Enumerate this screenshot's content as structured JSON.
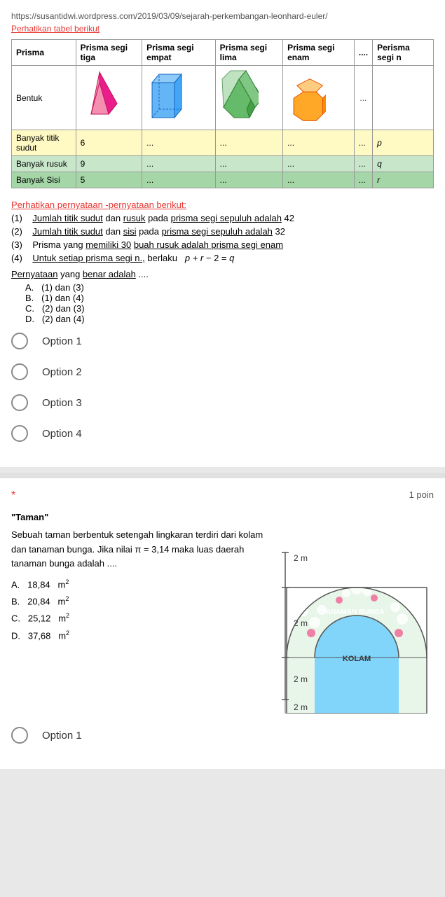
{
  "question1": {
    "url": "https://susantidwi.wordpress.com/2019/03/09/sejarah-perkembangan-leonhard-euler/",
    "note": "Perhatikan tabel berikut",
    "table": {
      "headers": [
        "Prisma",
        "Prisma segi tiga",
        "Prisma segi empat",
        "Prisma segi lima",
        "Prisma segi enam",
        "....",
        "Perisma segi n"
      ],
      "rows": [
        {
          "label": "Bentuk",
          "values": [
            "[shape-triangle]",
            "[shape-square]",
            "[shape-pentagon]",
            "[shape-hexagon]",
            "...",
            ""
          ]
        },
        {
          "label": "Banyak titik sudut",
          "values": [
            "6",
            "...",
            "...",
            "...",
            "...",
            "p"
          ],
          "class": "row-yellow"
        },
        {
          "label": "Banyak rusuk",
          "values": [
            "9",
            "...",
            "...",
            "...",
            "...",
            "q"
          ],
          "class": "row-green"
        },
        {
          "label": "Banyak Sisi",
          "values": [
            "5",
            "...",
            "...",
            "...",
            "...",
            "r"
          ],
          "class": "row-green2"
        }
      ]
    },
    "statements_header": "Perhatikan pernyataan -pernyataan berikut:",
    "statements": [
      "(1)   Jumlah titik sudut dan rusuk pada prisma segi sepuluh adalah 42",
      "(2)   Jumlah titik sudut dan sisi pada prisma segi sepuluh adalah 32",
      "(3)   Prisma yang memiliki 30 buah rusuk adalah prisma segi enam",
      "(4)   Untuk setiap prisma segi n., berlaku  p + r − 2 = q"
    ],
    "pernyataan": "Pernyataan yang benar adalah ....",
    "answers": [
      "A.   (1) dan (3)",
      "B.   (1) dan (4)",
      "C.   (2) dan (3)",
      "D.   (2) dan (4)"
    ],
    "options": [
      "Option 1",
      "Option 2",
      "Option 3",
      "Option 4"
    ]
  },
  "question2": {
    "points": "1 poin",
    "title": "\"Taman\"",
    "description": "Sebuah taman berbentuk setengah lingkaran terdiri dari kolam dan tanaman bunga. Jika nilai π = 3,14 maka luas daerah tanaman bunga adalah ....",
    "answers": [
      "A.   18,84  m²",
      "B.   20,84  m²",
      "C.   25,12  m²",
      "D.   37,68  m²"
    ],
    "diagram_labels": {
      "top": "2 m",
      "middle_top": "2 m",
      "middle": "KOLAM",
      "middle_bottom": "2 m",
      "bottom": "2 m",
      "flowers": "TANAMAN BUNGA"
    },
    "options": [
      "Option 1"
    ]
  }
}
